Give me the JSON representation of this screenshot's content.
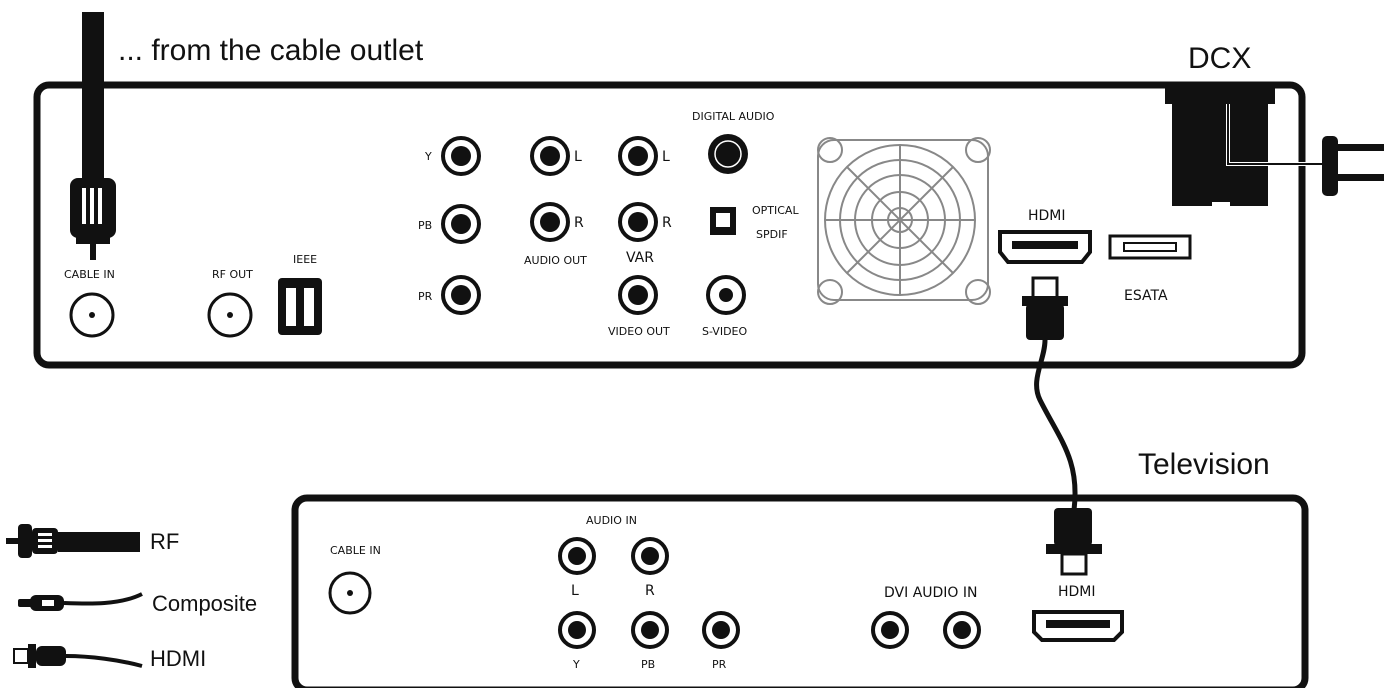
{
  "cable_outlet_label": "... from the cable outlet",
  "dcx": {
    "title": "DCX",
    "cable_in": "CABLE IN",
    "rf_out": "RF OUT",
    "ieee": "IEEE",
    "component": {
      "y": "Y",
      "pb": "PB",
      "pr": "PR"
    },
    "audio_out": {
      "l": "L",
      "r": "R",
      "label": "AUDIO OUT"
    },
    "var_audio": {
      "l": "L",
      "r": "R",
      "label": "VAR"
    },
    "digital_audio": "DIGITAL AUDIO",
    "optical": "OPTICAL",
    "spdif": "SPDIF",
    "video_out": "VIDEO OUT",
    "s_video": "S-VIDEO",
    "hdmi": "HDMI",
    "esata": "ESATA"
  },
  "tv": {
    "title": "Television",
    "cable_in": "CABLE IN",
    "audio_in": "AUDIO IN",
    "l": "L",
    "r": "R",
    "y": "Y",
    "pb": "PB",
    "pr": "PR",
    "dvi_audio_in": "DVI AUDIO IN",
    "hdmi": "HDMI"
  },
  "legend": [
    {
      "label": "RF",
      "icon": "rf-connector-icon"
    },
    {
      "label": "Composite",
      "icon": "composite-connector-icon"
    },
    {
      "label": "HDMI",
      "icon": "hdmi-connector-icon"
    }
  ]
}
